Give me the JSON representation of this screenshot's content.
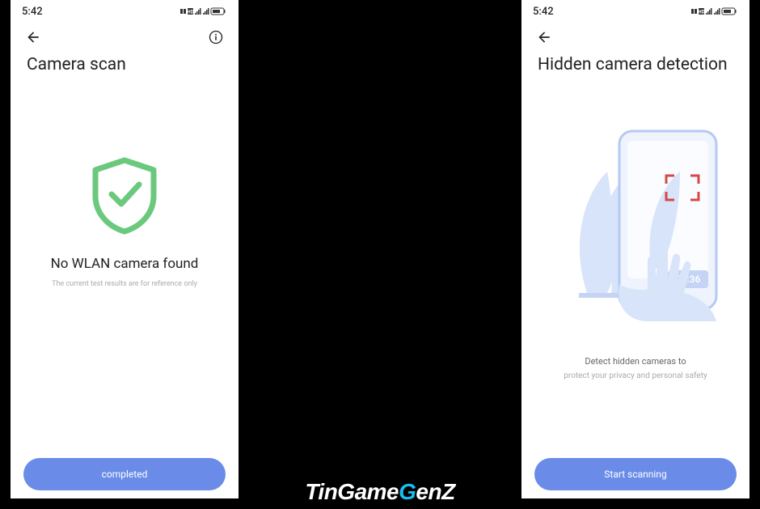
{
  "status": {
    "time": "5:42"
  },
  "left": {
    "title": "Camera scan",
    "result_title": "No WLAN camera found",
    "result_sub": "The current test results are for reference only",
    "button": "completed"
  },
  "right": {
    "title": "Hidden camera detection",
    "desc1": "Detect hidden cameras to",
    "desc2": "protect your privacy and personal safety",
    "button": "Start scanning",
    "illustration_time": "02:36"
  },
  "watermark": {
    "part1": "TinGame",
    "part2": "G",
    "part3": "enZ"
  }
}
